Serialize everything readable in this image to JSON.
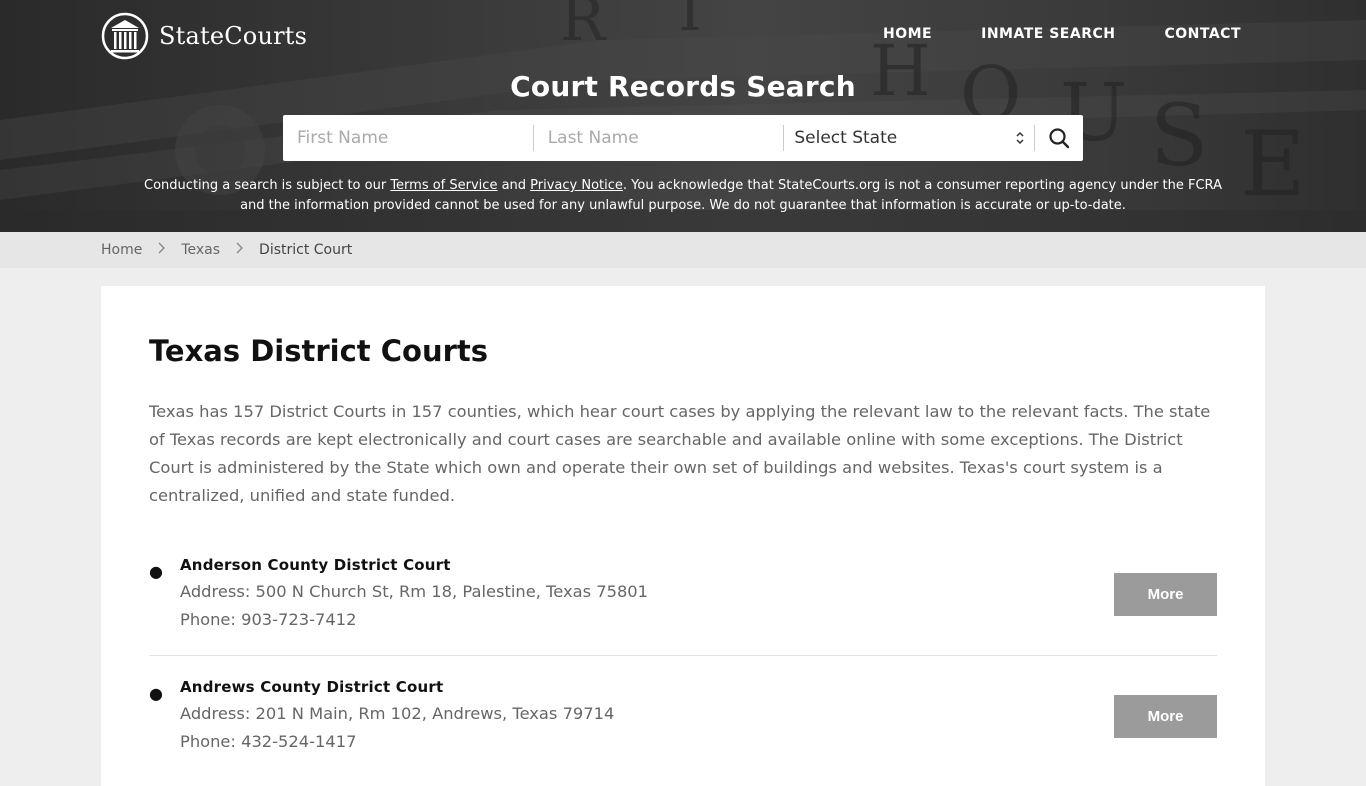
{
  "brand": {
    "name": "StateCourts"
  },
  "nav": {
    "home": "HOME",
    "inmate_search": "INMATE SEARCH",
    "contact": "CONTACT"
  },
  "hero": {
    "title": "Court Records Search",
    "first_name_placeholder": "First Name",
    "last_name_placeholder": "Last Name",
    "state_select_value": "Select State",
    "disclaimer": {
      "prefix": "Conducting a search is subject to our ",
      "terms_link": "Terms of Service",
      "and": " and ",
      "privacy_link": "Privacy Notice",
      "suffix": ". You acknowledge that StateCourts.org is not a consumer reporting agency under the FCRA and the information provided cannot be used for any unlawful purpose. We do not guarantee that information is accurate or up-to-date."
    }
  },
  "breadcrumb": {
    "home": "Home",
    "state": "Texas",
    "current": "District Court"
  },
  "main": {
    "title": "Texas District Courts",
    "intro": "Texas has 157 District Courts in 157 counties, which hear court cases by applying the relevant law to the relevant facts. The state of Texas records are kept electronically and court cases are searchable and available online with some exceptions. The District Court is administered by the State which own and operate their own set of buildings and websites. Texas's court system is a centralized, unified and state funded.",
    "courts": [
      {
        "name": "Anderson County District Court",
        "address": "Address: 500 N Church St, Rm 18, Palestine, Texas 75801",
        "phone": "Phone: 903-723-7412",
        "button": "More"
      },
      {
        "name": "Andrews County District Court",
        "address": "Address: 201 N Main, Rm 102, Andrews, Texas 79714",
        "phone": "Phone: 432-524-1417",
        "button": "More"
      }
    ]
  },
  "icons": {
    "logo": "courthouse-columns-icon",
    "search": "search-icon",
    "select_arrows": "updown-arrows-icon",
    "breadcrumb_sep": "chevron-right-icon"
  }
}
